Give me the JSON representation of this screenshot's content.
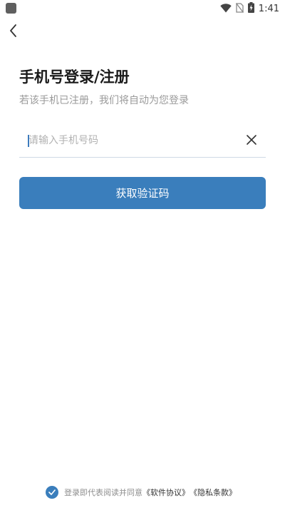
{
  "status_bar": {
    "time": "1:41",
    "icons": [
      "wifi-icon",
      "no-sim-icon",
      "battery-charging-icon"
    ]
  },
  "nav": {
    "back_icon": "chevron-left-icon"
  },
  "login": {
    "title": "手机号登录/注册",
    "subtitle": "若该手机已注册，我们将自动为您登录",
    "phone_placeholder": "请输入手机号码",
    "phone_value": "",
    "clear_icon": "close-icon",
    "get_code_label": "获取验证码"
  },
  "agreement": {
    "checked": true,
    "prefix": "登录即代表阅读并同意",
    "software_agreement": "《软件协议》",
    "privacy_policy": "《隐私条款》"
  },
  "colors": {
    "primary": "#3a7ebc",
    "caret": "#3d7bbd",
    "input_underline": "#cfd9e6",
    "subtitle": "#9a9a9a"
  }
}
